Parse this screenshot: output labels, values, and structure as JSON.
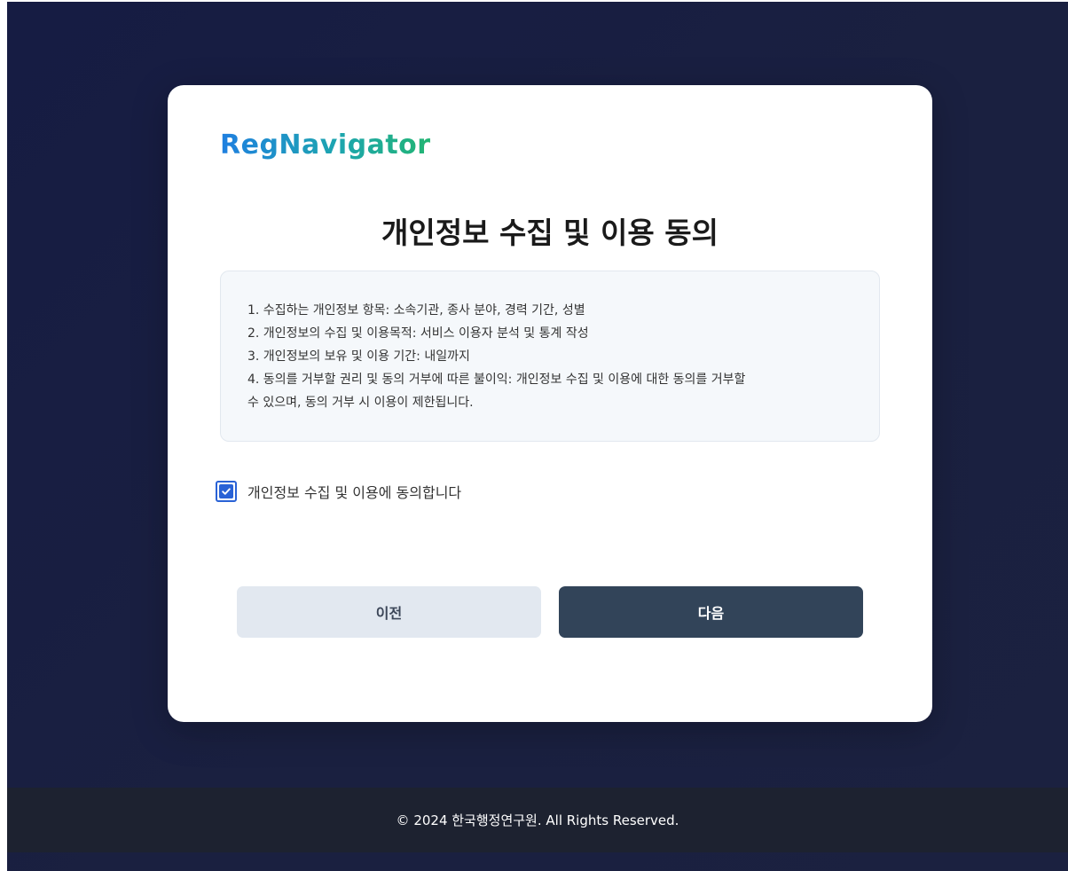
{
  "brand": {
    "logo_text": "RegNavigator"
  },
  "consent": {
    "title": "개인정보 수집 및 이용 동의",
    "notice_lines": [
      "1. 수집하는 개인정보 항목: 소속기관, 종사 분야, 경력 기간, 성별",
      "2. 개인정보의 수집 및 이용목적: 서비스 이용자 분석 및 통계 작성",
      "3. 개인정보의 보유 및 이용 기간: 내일까지",
      "4. 동의를 거부할 권리 및 동의 거부에 따른 불이익: 개인정보 수집 및 이용에 대한 동의를 거부할",
      "수 있으며, 동의 거부 시 이용이 제한됩니다."
    ],
    "agree_label": "개인정보 수집 및 이용에 동의합니다",
    "agree_checked": true
  },
  "actions": {
    "prev_label": "이전",
    "next_label": "다음"
  },
  "footer": {
    "copyright": "© 2024 한국행정연구원. All Rights Reserved."
  },
  "colors": {
    "background": "#161c43",
    "card": "#ffffff",
    "accent_blue": "#2962d6",
    "next_button": "#324459",
    "prev_button": "#e2e8f0",
    "footer": "#1d2230"
  },
  "icons": {
    "checkbox": "check-icon"
  }
}
